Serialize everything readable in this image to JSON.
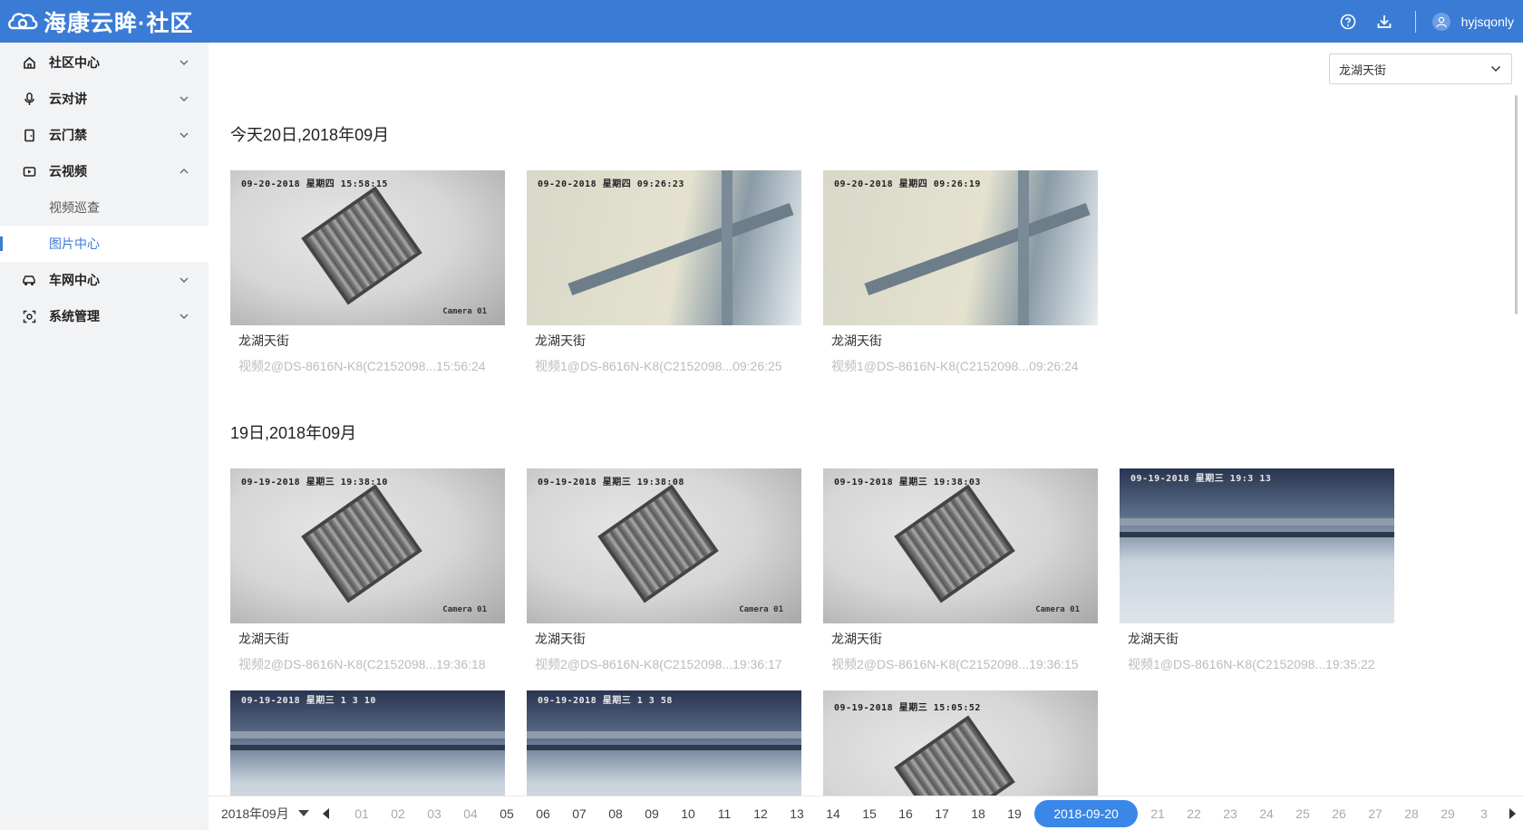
{
  "header": {
    "logo_text": "海康云眸·社区",
    "username": "hyjsqonly",
    "bg_color": "#3a7bd5"
  },
  "sidebar": {
    "items": [
      {
        "label": "社区中心",
        "icon": "home-icon",
        "expanded": false
      },
      {
        "label": "云对讲",
        "icon": "microphone-icon",
        "expanded": false
      },
      {
        "label": "云门禁",
        "icon": "door-icon",
        "expanded": false
      },
      {
        "label": "云视频",
        "icon": "video-icon",
        "expanded": true
      },
      {
        "label": "车网中心",
        "icon": "car-icon",
        "expanded": false
      },
      {
        "label": "系统管理",
        "icon": "settings-icon",
        "expanded": false
      }
    ],
    "sub_items": [
      {
        "label": "视频巡查",
        "active": false
      },
      {
        "label": "图片中心",
        "active": true
      }
    ]
  },
  "main": {
    "community_select": "龙湖天街",
    "sections": [
      {
        "title": "今天20日,2018年09月",
        "cards": [
          {
            "timestamp": "09-20-2018 星期四 15:58:15",
            "camera": "Camera 01",
            "scene": "ceiling",
            "location": "龙湖天街",
            "desc": "视频2@DS-8616N-K8(C2152098...15:56:24"
          },
          {
            "timestamp": "09-20-2018 星期四 09:26:23",
            "camera": "",
            "scene": "wall",
            "location": "龙湖天街",
            "desc": "视频1@DS-8616N-K8(C2152098...09:26:25"
          },
          {
            "timestamp": "09-20-2018 星期四 09:26:19",
            "camera": "",
            "scene": "wall",
            "location": "龙湖天街",
            "desc": "视频1@DS-8616N-K8(C2152098...09:26:24"
          }
        ]
      },
      {
        "title": "19日,2018年09月",
        "cards": [
          {
            "timestamp": "09-19-2018 星期三 19:38:10",
            "camera": "Camera 01",
            "scene": "ceiling",
            "location": "龙湖天街",
            "desc": "视频2@DS-8616N-K8(C2152098...19:36:18"
          },
          {
            "timestamp": "09-19-2018 星期三 19:38:08",
            "camera": "Camera 01",
            "scene": "ceiling",
            "location": "龙湖天街",
            "desc": "视频2@DS-8616N-K8(C2152098...19:36:17"
          },
          {
            "timestamp": "09-19-2018 星期三 19:38:03",
            "camera": "Camera 01",
            "scene": "ceiling",
            "location": "龙湖天街",
            "desc": "视频2@DS-8616N-K8(C2152098...19:36:15"
          },
          {
            "timestamp": "09-19-2018 星期三 19:3 13",
            "camera": "",
            "scene": "room",
            "location": "龙湖天街",
            "desc": "视频1@DS-8616N-K8(C2152098...19:35:22"
          },
          {
            "timestamp": "09-19-2018 星期三 1 3 10",
            "camera": "",
            "scene": "room",
            "location": "",
            "desc": ""
          },
          {
            "timestamp": "09-19-2018 星期三 1 3 58",
            "camera": "",
            "scene": "room",
            "location": "",
            "desc": ""
          },
          {
            "timestamp": "09-19-2018 星期三 15:05:52",
            "camera": "",
            "scene": "ceiling",
            "location": "",
            "desc": ""
          }
        ]
      }
    ]
  },
  "datebar": {
    "month": "2018年09月",
    "days": [
      "01",
      "02",
      "03",
      "04",
      "05",
      "06",
      "07",
      "08",
      "09",
      "10",
      "11",
      "12",
      "13",
      "14",
      "15",
      "16",
      "17",
      "18",
      "19",
      "2018-09-20",
      "21",
      "22",
      "23",
      "24",
      "25",
      "26",
      "27",
      "28",
      "29",
      "3"
    ],
    "selected": "2018-09-20",
    "muted_days": [
      "01",
      "02",
      "03",
      "04",
      "21",
      "22",
      "23",
      "24",
      "25",
      "26",
      "27",
      "28",
      "29",
      "3"
    ],
    "accent": "#3a87e8"
  }
}
